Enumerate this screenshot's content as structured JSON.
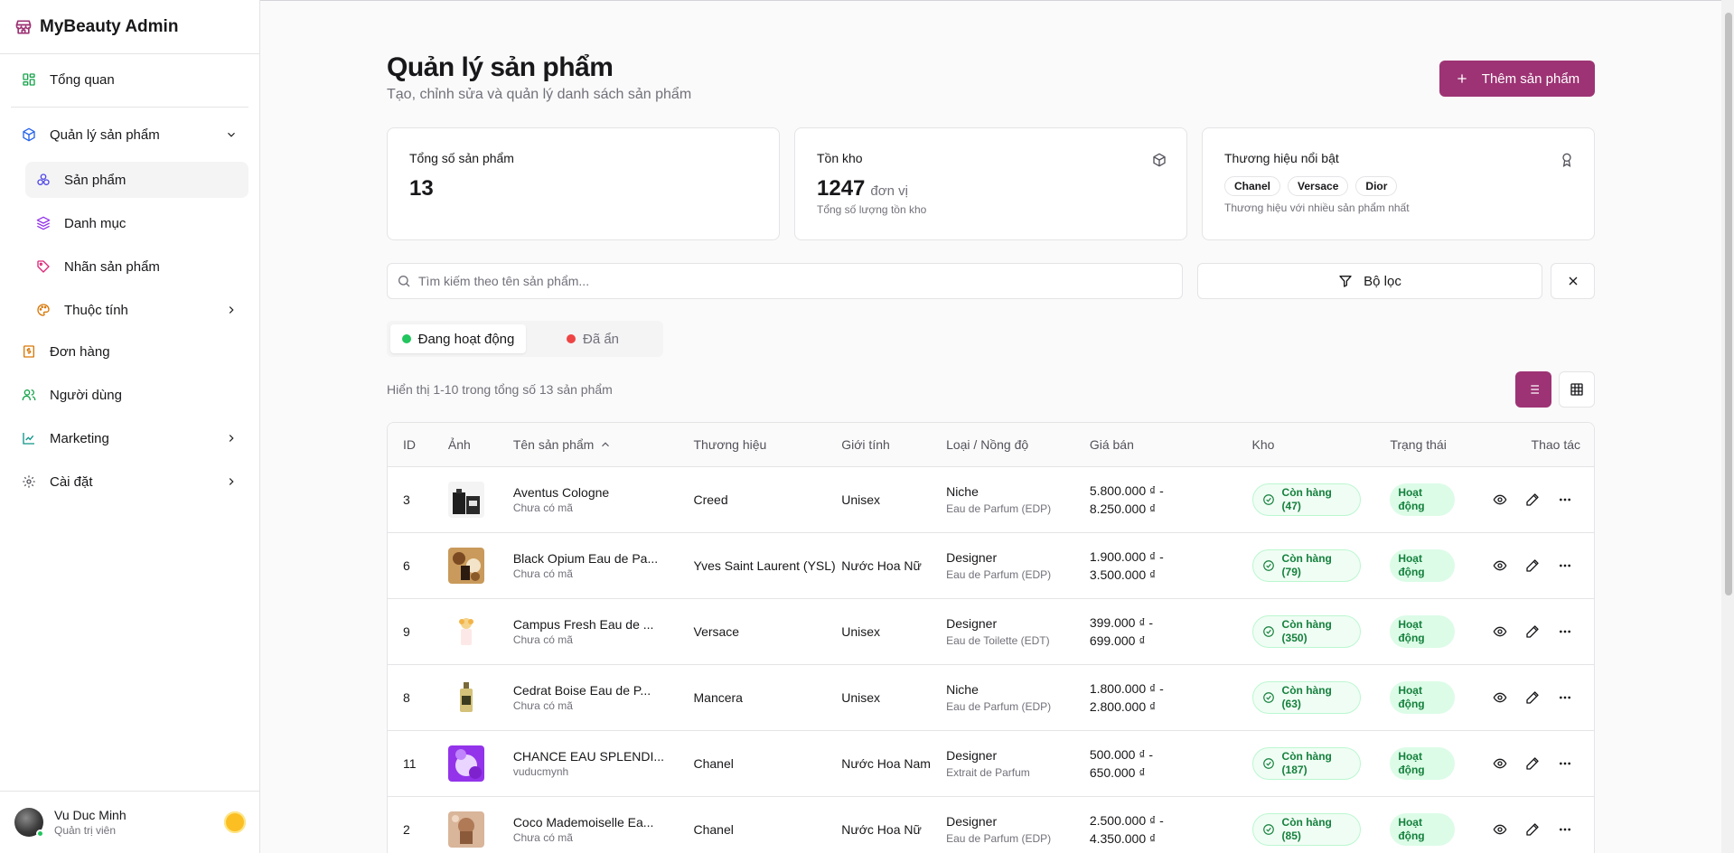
{
  "app": {
    "title": "MyBeauty Admin"
  },
  "colors": {
    "accent": "#9d3374",
    "success": "#15803d",
    "active_dot": "#22c55e",
    "hidden_dot": "#ef4444"
  },
  "sidebar": {
    "overview": "Tổng quan",
    "products_group": "Quản lý sản phẩm",
    "sub_items": [
      "Sản phẩm",
      "Danh mục",
      "Nhãn sản phẩm",
      "Thuộc tính"
    ],
    "orders": "Đơn hàng",
    "users": "Người dùng",
    "marketing": "Marketing",
    "settings": "Cài đặt"
  },
  "user": {
    "name": "Vu Duc Minh",
    "role": "Quản trị viên"
  },
  "page": {
    "title": "Quản lý sản phẩm",
    "subtitle": "Tạo, chỉnh sửa và quản lý danh sách sản phẩm",
    "add_button": "Thêm sản phẩm"
  },
  "stats": {
    "total": {
      "title": "Tổng số sản phẩm",
      "value": "13"
    },
    "stock": {
      "title": "Tồn kho",
      "value": "1247",
      "unit": "đơn vị",
      "note": "Tổng số lượng tồn kho"
    },
    "brands": {
      "title": "Thương hiệu nổi bật",
      "chips": [
        "Chanel",
        "Versace",
        "Dior"
      ],
      "note": "Thương hiệu với nhiều sản phẩm nhất"
    }
  },
  "search": {
    "placeholder": "Tìm kiếm theo tên sản phẩm..."
  },
  "filter": {
    "label": "Bộ lọc"
  },
  "tabs": {
    "active": "Đang hoạt động",
    "hidden": "Đã ẩn"
  },
  "showing": "Hiển thị 1-10 trong tổng số 13 sản phẩm",
  "table": {
    "headers": [
      "ID",
      "Ảnh",
      "Tên sản phẩm",
      "Thương hiệu",
      "Giới tính",
      "Loại / Nồng độ",
      "Giá bán",
      "Kho",
      "Trạng thái",
      "Thao tác"
    ],
    "rows": [
      {
        "id": "3",
        "name": "Aventus Cologne",
        "code": "Chưa có mã",
        "brand": "Creed",
        "gender": "Unisex",
        "type": "Niche",
        "conc": "Eau de Parfum (EDP)",
        "price1": "5.800.000 ₫ -",
        "price2": "8.250.000 ₫",
        "stock1": "Còn hàng",
        "stock2": "(47)",
        "status1": "Hoạt",
        "status2": "động"
      },
      {
        "id": "6",
        "name": "Black Opium Eau de Pa...",
        "code": "Chưa có mã",
        "brand": "Yves Saint Laurent (YSL)",
        "gender": "Nước Hoa Nữ",
        "type": "Designer",
        "conc": "Eau de Parfum (EDP)",
        "price1": "1.900.000 ₫ -",
        "price2": "3.500.000 ₫",
        "stock1": "Còn hàng",
        "stock2": "(79)",
        "status1": "Hoạt",
        "status2": "động"
      },
      {
        "id": "9",
        "name": "Campus Fresh Eau de ...",
        "code": "Chưa có mã",
        "brand": "Versace",
        "gender": "Unisex",
        "type": "Designer",
        "conc": "Eau de Toilette (EDT)",
        "price1": "399.000 ₫ -",
        "price2": "699.000 ₫",
        "stock1": "Còn hàng",
        "stock2": "(350)",
        "status1": "Hoạt",
        "status2": "động"
      },
      {
        "id": "8",
        "name": "Cedrat Boise Eau de P...",
        "code": "Chưa có mã",
        "brand": "Mancera",
        "gender": "Unisex",
        "type": "Niche",
        "conc": "Eau de Parfum (EDP)",
        "price1": "1.800.000 ₫ -",
        "price2": "2.800.000 ₫",
        "stock1": "Còn hàng",
        "stock2": "(63)",
        "status1": "Hoạt",
        "status2": "động"
      },
      {
        "id": "11",
        "name": "CHANCE EAU SPLENDI...",
        "code": "vuducmynh",
        "brand": "Chanel",
        "gender": "Nước Hoa Nam",
        "type": "Designer",
        "conc": "Extrait de Parfum",
        "price1": "500.000 ₫ -",
        "price2": "650.000 ₫",
        "stock1": "Còn hàng",
        "stock2": "(187)",
        "status1": "Hoạt",
        "status2": "động"
      },
      {
        "id": "2",
        "name": "Coco Mademoiselle Ea...",
        "code": "Chưa có mã",
        "brand": "Chanel",
        "gender": "Nước Hoa Nữ",
        "type": "Designer",
        "conc": "Eau de Parfum (EDP)",
        "price1": "2.500.000 ₫ -",
        "price2": "4.350.000 ₫",
        "stock1": "Còn hàng",
        "stock2": "(85)",
        "status1": "Hoạt",
        "status2": "động"
      }
    ]
  }
}
